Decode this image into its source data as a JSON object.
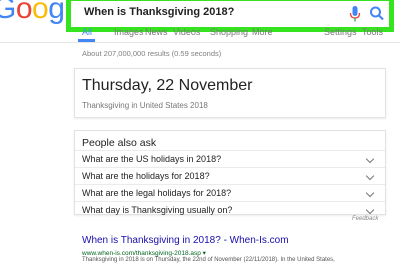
{
  "logo": {
    "text": "Google"
  },
  "search": {
    "query": "When is Thanksgiving 2018?"
  },
  "tabs": [
    {
      "label": "All",
      "active": true
    },
    {
      "label": "Images",
      "active": false
    },
    {
      "label": "News",
      "active": false
    },
    {
      "label": "Videos",
      "active": false
    },
    {
      "label": "Shopping",
      "active": false
    },
    {
      "label": "More",
      "active": false
    }
  ],
  "tools": {
    "settings": "Settings",
    "tools": "Tools"
  },
  "stats": "About 207,000,000 results (0.59 seconds)",
  "answer": {
    "title": "Thursday, 22 November",
    "subtitle": "Thanksgiving in United States 2018"
  },
  "people_also_ask": {
    "title": "People also ask",
    "questions": [
      "What are the US holidays in 2018?",
      "What are the holidays for 2018?",
      "What are the legal holidays for 2018?",
      "What day is Thanksgiving usually on?"
    ]
  },
  "feedback": "Feedback",
  "result": {
    "title": "When is Thanksgiving in 2018? - When-Is.com",
    "url": "www.when-is.com/thanksgiving-2018.asp ▾",
    "snippet": "Thanksgiving in 2018 is on Thursday, the 22nd of November (22/11/2018). In the United States,"
  },
  "colors": {
    "accent": "#4285f4",
    "highlight_outline": "#35e41f",
    "link": "#1a0dab",
    "url": "#006621"
  }
}
